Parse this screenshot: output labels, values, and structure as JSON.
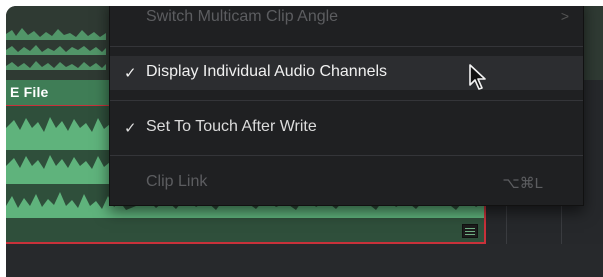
{
  "timeline": {
    "clip_name": "E File"
  },
  "context_menu": {
    "items": [
      {
        "label": "Switch Multicam Clip Angle",
        "checked": false,
        "enabled": false,
        "has_submenu": true,
        "shortcut": ""
      },
      {
        "label": "Display Individual Audio Channels",
        "checked": true,
        "enabled": true,
        "hovered": true,
        "has_submenu": false,
        "shortcut": ""
      },
      {
        "label": "Set To Touch After Write",
        "checked": true,
        "enabled": true,
        "has_submenu": false,
        "shortcut": ""
      },
      {
        "label": "Clip Link",
        "checked": false,
        "enabled": false,
        "has_submenu": false,
        "shortcut": "⌥⌘L"
      }
    ],
    "check_glyph": "✓",
    "submenu_glyph": ">"
  },
  "colors": {
    "clip_green": "#3f7d56",
    "waveform_green": "#5fb37c",
    "clip_selection_red": "#c8313a",
    "menu_background": "#1f2022"
  }
}
